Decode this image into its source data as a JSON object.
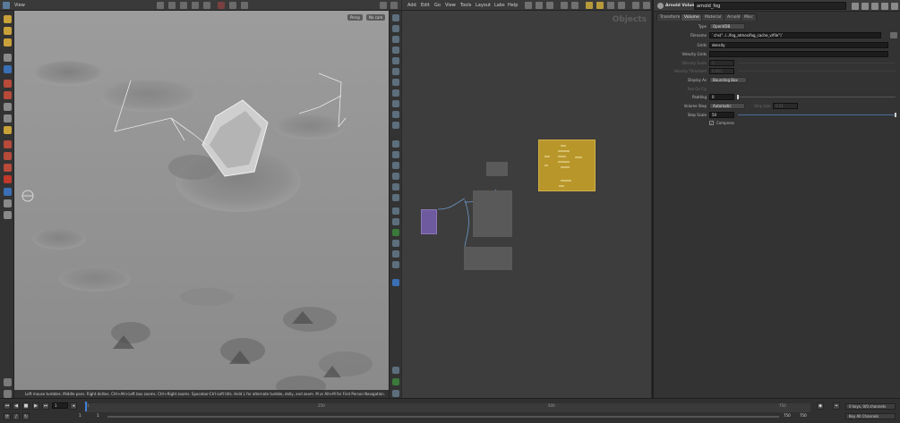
{
  "viewport_pane": {
    "label": "View",
    "camera_button": "Persp",
    "display_button": "No cam",
    "hint": "Left mouse tumbles. Middle pans. Right dollies. Ctrl+Alt+Left box zooms. Ctrl+Right zooms. Spacebar-Ctrl-Left tilts. Hold L for alternate tumble, dolly, and zoom.   M or Alt+M for First Person Navigation."
  },
  "network_pane": {
    "menu": [
      "Add",
      "Edit",
      "Go",
      "View",
      "Tools",
      "Layout",
      "Labs",
      "Help"
    ],
    "context_title": "Objects"
  },
  "parameters": {
    "node_type": "Arnold Volume",
    "node_name": "arnold_fog",
    "tabs": [
      "Transform",
      "Volume",
      "Material",
      "Arnold",
      "Misc"
    ],
    "active_tab": "Volume",
    "rows": {
      "type": {
        "label": "Type",
        "value": "OpenVDB"
      },
      "filename": {
        "label": "Filename",
        "value": "`chs(\"../../fog_atmos/fog_cache_v/file\")`"
      },
      "grids": {
        "label": "Grids",
        "value": "density"
      },
      "velocity_grids": {
        "label": "Velocity Grids",
        "value": ""
      },
      "velocity_scale": {
        "label": "Velocity Scale",
        "value": "1"
      },
      "velocity_threshold": {
        "label": "Velocity Threshold",
        "value": "0.001"
      },
      "display_as": {
        "label": "Display As",
        "value": "Bounding Box"
      },
      "res_on_fly": {
        "label": "Res On Fly",
        "value": ""
      },
      "padding": {
        "label": "Padding",
        "value": "0"
      },
      "volume_step": {
        "label": "Volume Step",
        "value": "Automatic"
      },
      "step_size": {
        "label": "Step Size",
        "value": "0.01"
      },
      "step_scale": {
        "label": "Step Scale",
        "value": "50"
      },
      "compress": {
        "label": "Compress",
        "checked": true
      }
    }
  },
  "timeline": {
    "current_frame": "1",
    "start_frame": "1",
    "start_frame_2": "1",
    "end_frame": "750",
    "end_frame_2": "750",
    "tick_labels": [
      "1",
      "250",
      "500",
      "750"
    ],
    "keys_info": "0 keys, 0/0 channels",
    "key_all_channels": "Key All Channels"
  },
  "colors": {
    "subnet_node": "#b8962a",
    "purple_node": "#6e5a9e",
    "playhead": "#3f7fd9"
  }
}
